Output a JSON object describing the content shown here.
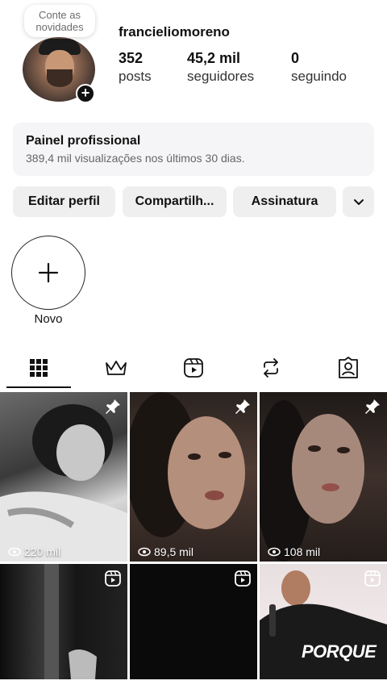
{
  "profile": {
    "note": "Conte as novidades",
    "username": "francieliomoreno",
    "stats": [
      {
        "value": "352",
        "label": "posts"
      },
      {
        "value": "45,2 mil",
        "label": "seguidores"
      },
      {
        "value": "0",
        "label": "seguindo"
      }
    ]
  },
  "panel": {
    "title": "Painel profissional",
    "subtitle": "389,4 mil visualizações nos últimos 30 dias."
  },
  "buttons": {
    "edit": "Editar perfil",
    "share": "Compartilh...",
    "subscription": "Assinatura"
  },
  "highlights": {
    "new_label": "Novo"
  },
  "tabs": [
    "grid-icon",
    "crown-icon",
    "reels-icon",
    "repost-icon",
    "tagged-icon"
  ],
  "grid": [
    {
      "views": "220 mil",
      "pinned": true
    },
    {
      "views": "89,5 mil",
      "pinned": true
    },
    {
      "views": "108 mil",
      "pinned": true
    },
    {
      "views": "",
      "reel": true
    },
    {
      "views": "",
      "reel": true
    },
    {
      "views": "",
      "reel": true,
      "overlay_text": "PORQUE"
    }
  ],
  "colors": {
    "text": "#111111",
    "button_bg": "#efefef",
    "panel_bg": "#f5f5f7"
  }
}
